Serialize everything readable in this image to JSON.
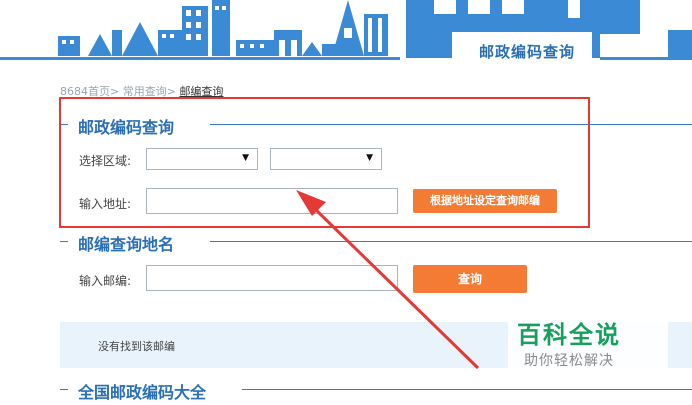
{
  "banner": {
    "label": "邮政编码查询"
  },
  "breadcrumb": {
    "home": "8684首页",
    "sep1": ">",
    "cat": "常用查询",
    "sep2": ">",
    "current": "邮编查询"
  },
  "section1": {
    "title": "邮政编码查询",
    "region_label": "选择区域:",
    "region_select1": "",
    "region_select2": "",
    "address_label": "输入地址:",
    "address_value": "",
    "submit_label": "根据地址设定查询邮编"
  },
  "section2": {
    "title": "邮编查询地名",
    "postcode_label": "输入邮编:",
    "postcode_value": "",
    "query_label": "查询"
  },
  "notice": {
    "text": "没有找到该邮编"
  },
  "section3": {
    "title": "全国邮政编码大全"
  },
  "watermark": {
    "title": "百科全说",
    "subtitle": "助你轻松解决"
  },
  "colors": {
    "accent": "#2a6fb5",
    "button": "#f47b34",
    "highlight": "#e53935",
    "watermark": "#17a05d"
  }
}
